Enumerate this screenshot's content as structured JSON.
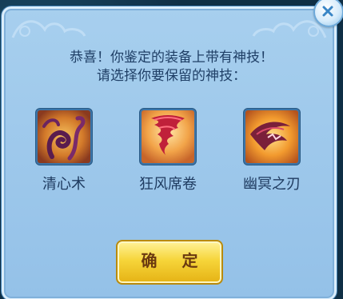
{
  "dialog": {
    "message_line1": "恭喜！你鉴定的装备上带有神技！",
    "message_line2": "请选择你要保留的神技：",
    "close_icon": "close-icon",
    "confirm_label": "确 定"
  },
  "skills": [
    {
      "name": "清心术",
      "icon": "swirl-tentacle-icon"
    },
    {
      "name": "狂风席卷",
      "icon": "tornado-icon"
    },
    {
      "name": "幽冥之刃",
      "icon": "dark-blade-icon"
    }
  ],
  "colors": {
    "panel": "#9ec8ec",
    "text": "#1f3f66",
    "button": "#f6d53a"
  }
}
